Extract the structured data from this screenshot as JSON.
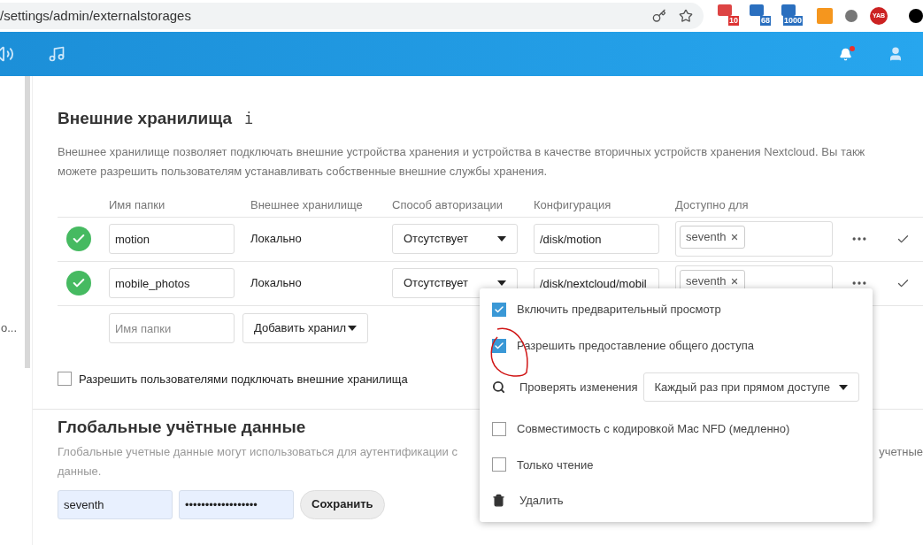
{
  "browser": {
    "url": "/settings/admin/externalstorages",
    "extension_badges": [
      "10",
      "68",
      "1000"
    ],
    "extension_label": "YAB"
  },
  "sidebar": {
    "truncated_item": "о..."
  },
  "section": {
    "title": "Внешние хранилища",
    "info": "i",
    "description": "Внешнее хранилище позволяет подключать внешние устройства хранения и устройства в качестве вторичных устройств хранения Nextcloud. Вы такж",
    "description_line2": "можете разрешить пользователям устанавливать собственные внешние службы хранения.",
    "columns": [
      "Имя папки",
      "Внешнее хранилище",
      "Способ авторизации",
      "Конфигурация",
      "Доступно для"
    ],
    "mounts": [
      {
        "enabled": true,
        "folder": "motion",
        "backend": "Локально",
        "auth": "Отсутствует",
        "config": "/disk/motion",
        "users": [
          "seventh"
        ]
      },
      {
        "enabled": true,
        "folder": "mobile_photos",
        "backend": "Локально",
        "auth": "Отсутствует",
        "config": "/disk/nextcloud/mobil",
        "users": [
          "seventh"
        ]
      }
    ],
    "new_mount": {
      "placeholder": "Имя папки",
      "add": "Добавить хранил"
    },
    "allow_user_mounting": {
      "label": "Разрешить пользователями подключать внешние хранилища",
      "checked": false
    }
  },
  "global_credentials": {
    "title": "Глобальные учётные данные",
    "description": "Глобальные учетные данные могут использоваться для аутентификации с",
    "description_right": "учетные",
    "description_line2": "данные.",
    "login": "seventh",
    "password": "••••••••••••••••••",
    "save": "Сохранить"
  },
  "menu": {
    "items": [
      {
        "kind": "checkbox",
        "label": "Включить предварительный просмотр",
        "checked": true
      },
      {
        "kind": "checkbox",
        "label": "Разрешить предоставление общего доступа",
        "checked": true
      },
      {
        "kind": "select",
        "label": "Проверять изменения",
        "value": "Каждый раз при прямом доступе"
      },
      {
        "kind": "checkbox",
        "label": "Совместимость с кодировкой Mac NFD (медленно)",
        "checked": false
      },
      {
        "kind": "checkbox",
        "label": "Только чтение",
        "checked": false
      },
      {
        "kind": "action",
        "label": "Удалить"
      }
    ]
  }
}
